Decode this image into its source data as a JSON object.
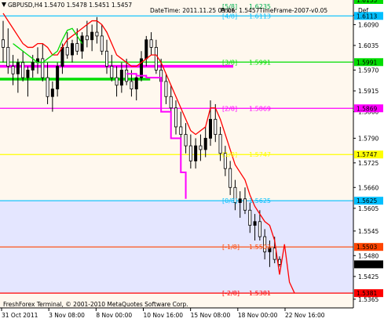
{
  "header": {
    "symbol": "GBPUSD,H4",
    "ohlc": "1.5470 1.5478 1.5451 1.5457",
    "datetime": "DateTime: 2011.11.25 09:06",
    "price": "Price: 1.5457",
    "timeframe": "TimeFrame-2007-v0.05",
    "hidden_label": "Def"
  },
  "footer": {
    "copyright": "FreshForex Terminal, © 2001-2010 MetaQuotes Software Corp."
  },
  "colors": {
    "background": "#FFF8EE",
    "shade": "#E4E6FF",
    "candle": "#000000",
    "stop_line": "#FF0000",
    "fast_line": "#00DD00",
    "trail_line": "#FF00FF",
    "axis": "#000000"
  },
  "chart_data": {
    "type": "candlestick",
    "title": "GBPUSD,H4",
    "ylim": [
      1.5342,
      1.6155
    ],
    "x_labels": [
      "31 Oct 2011",
      "3 Nov 08:00",
      "8 Nov 00:00",
      "10 Nov 16:00",
      "15 Nov 08:00",
      "18 Nov 00:00",
      "22 Nov 16:00"
    ],
    "y_ticks": [
      "1.6115",
      "1.6090",
      "1.6035",
      "1.5970",
      "1.5915",
      "1.5860",
      "1.5790",
      "1.5725",
      "1.5660",
      "1.5605",
      "1.5545",
      "1.5480",
      "1.5425",
      "1.5365"
    ],
    "murrey_levels": [
      {
        "label": "[5/8]",
        "value": 1.6235,
        "price_tag": "",
        "color": "#00B050",
        "line": false
      },
      {
        "label": "[4/8]",
        "value": 1.6113,
        "price_tag": "1.6113",
        "color": "#00BFFF",
        "line": true
      },
      {
        "label": "[3/8]",
        "value": 1.5991,
        "price_tag": "1.5991",
        "color": "#00DD00",
        "line": true
      },
      {
        "label": "[2/8]",
        "value": 1.5869,
        "price_tag": "1.5869",
        "color": "#FF00FF",
        "line": true
      },
      {
        "label": "[1/8]",
        "value": 1.5747,
        "price_tag": "1.5747",
        "color": "#FFFF00",
        "line": true
      },
      {
        "label": "[0/8]",
        "value": 1.5625,
        "price_tag": "1.5625",
        "color": "#00BFFF",
        "line": true
      },
      {
        "label": "[-1/8]",
        "value": 1.5503,
        "price_tag": "1.5503",
        "color": "#FF4500",
        "line": true
      },
      {
        "label": "[-2/8]",
        "value": 1.5381,
        "price_tag": "1.5381",
        "color": "#FF0000",
        "line": true
      }
    ],
    "extra_levels": [
      {
        "value": 1.6155,
        "price_tag": "1.6155",
        "color": "#00DD00"
      },
      {
        "value": 1.5457,
        "price_tag": "1.5457",
        "color": "#000000"
      }
    ],
    "thick_lines": [
      {
        "name": "green",
        "value": 1.5946,
        "x_from": 0,
        "x_to": 0.425,
        "color": "#00DD00"
      },
      {
        "name": "magenta",
        "value": 1.598,
        "x_from": 0,
        "x_to": 0.66,
        "color": "#FF00FF"
      }
    ],
    "candles": [
      [
        1.605,
        1.61,
        1.599,
        1.603
      ],
      [
        1.603,
        1.608,
        1.596,
        1.598
      ],
      [
        1.598,
        1.601,
        1.593,
        1.596
      ],
      [
        1.596,
        1.6,
        1.591,
        1.599
      ],
      [
        1.599,
        1.602,
        1.594,
        1.595
      ],
      [
        1.595,
        1.598,
        1.59,
        1.597
      ],
      [
        1.597,
        1.601,
        1.595,
        1.599
      ],
      [
        1.599,
        1.603,
        1.596,
        1.6
      ],
      [
        1.6,
        1.604,
        1.594,
        1.595
      ],
      [
        1.595,
        1.599,
        1.588,
        1.59
      ],
      [
        1.59,
        1.594,
        1.586,
        1.592
      ],
      [
        1.592,
        1.599,
        1.59,
        1.598
      ],
      [
        1.598,
        1.604,
        1.596,
        1.603
      ],
      [
        1.603,
        1.607,
        1.6,
        1.601
      ],
      [
        1.601,
        1.605,
        1.599,
        1.604
      ],
      [
        1.604,
        1.608,
        1.601,
        1.602
      ],
      [
        1.602,
        1.607,
        1.6,
        1.606
      ],
      [
        1.606,
        1.61,
        1.603,
        1.605
      ],
      [
        1.605,
        1.609,
        1.602,
        1.607
      ],
      [
        1.607,
        1.611,
        1.604,
        1.606
      ],
      [
        1.606,
        1.609,
        1.601,
        1.602
      ],
      [
        1.602,
        1.605,
        1.596,
        1.598
      ],
      [
        1.598,
        1.601,
        1.594,
        1.595
      ],
      [
        1.595,
        1.598,
        1.59,
        1.593
      ],
      [
        1.593,
        1.599,
        1.591,
        1.597
      ],
      [
        1.597,
        1.6,
        1.593,
        1.594
      ],
      [
        1.594,
        1.597,
        1.59,
        1.592
      ],
      [
        1.592,
        1.596,
        1.589,
        1.595
      ],
      [
        1.595,
        1.602,
        1.594,
        1.6
      ],
      [
        1.6,
        1.606,
        1.598,
        1.605
      ],
      [
        1.605,
        1.607,
        1.601,
        1.603
      ],
      [
        1.603,
        1.605,
        1.596,
        1.597
      ],
      [
        1.597,
        1.6,
        1.592,
        1.594
      ],
      [
        1.594,
        1.596,
        1.588,
        1.59
      ],
      [
        1.59,
        1.593,
        1.585,
        1.587
      ],
      [
        1.587,
        1.589,
        1.58,
        1.582
      ],
      [
        1.582,
        1.586,
        1.578,
        1.58
      ],
      [
        1.58,
        1.583,
        1.575,
        1.577
      ],
      [
        1.577,
        1.58,
        1.571,
        1.573
      ],
      [
        1.573,
        1.579,
        1.571,
        1.577
      ],
      [
        1.577,
        1.58,
        1.573,
        1.576
      ],
      [
        1.576,
        1.582,
        1.574,
        1.579
      ],
      [
        1.579,
        1.589,
        1.577,
        1.584
      ],
      [
        1.584,
        1.588,
        1.578,
        1.58
      ],
      [
        1.58,
        1.582,
        1.573,
        1.575
      ],
      [
        1.575,
        1.577,
        1.569,
        1.571
      ],
      [
        1.571,
        1.573,
        1.564,
        1.566
      ],
      [
        1.566,
        1.568,
        1.56,
        1.562
      ],
      [
        1.562,
        1.565,
        1.558,
        1.563
      ],
      [
        1.563,
        1.566,
        1.559,
        1.56
      ],
      [
        1.56,
        1.562,
        1.554,
        1.556
      ],
      [
        1.556,
        1.559,
        1.552,
        1.557
      ],
      [
        1.557,
        1.56,
        1.552,
        1.553
      ],
      [
        1.553,
        1.555,
        1.547,
        1.549
      ],
      [
        1.549,
        1.552,
        1.545,
        1.55
      ],
      [
        1.55,
        1.553,
        1.546,
        1.547
      ],
      [
        1.547,
        1.5478,
        1.5451,
        1.5457
      ]
    ],
    "stop_line": [
      1.612,
      1.61,
      1.608,
      1.606,
      1.604,
      1.603,
      1.603,
      1.604,
      1.604,
      1.603,
      1.601,
      1.601,
      1.603,
      1.605,
      1.606,
      1.607,
      1.608,
      1.609,
      1.61,
      1.61,
      1.609,
      1.607,
      1.604,
      1.601,
      1.6,
      1.599,
      1.598,
      1.598,
      1.599,
      1.6,
      1.601,
      1.601,
      1.599,
      1.596,
      1.593,
      1.59,
      1.587,
      1.584,
      1.581,
      1.58,
      1.581,
      1.582,
      1.587,
      1.587,
      1.584,
      1.58,
      1.576,
      1.572,
      1.57,
      1.568,
      1.564,
      1.561,
      1.559,
      1.557,
      1.556,
      1.552,
      1.543,
      1.551,
      1.541,
      1.5382
    ],
    "stop_line_step": 1,
    "fast_line": [
      1.604,
      1.603,
      1.602,
      1.601,
      1.6,
      1.599,
      1.599,
      1.6,
      1.601,
      1.602,
      1.605,
      1.6075,
      1.608,
      1.606,
      1.604
    ],
    "fast_line_start": 2,
    "trail_line": [
      1.596,
      1.596,
      1.5955,
      1.5955,
      1.595,
      1.595,
      1.595,
      1.586,
      1.586,
      1.579,
      1.579,
      1.57,
      1.563
    ],
    "trail_line_start": 25
  }
}
